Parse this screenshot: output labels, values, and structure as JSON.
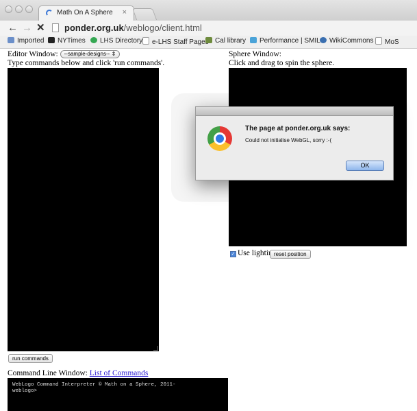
{
  "browser": {
    "tab_title": "Math On A Sphere",
    "tab_close": "×",
    "back_glyph": "←",
    "forward_glyph": "→",
    "stop_glyph": "✕",
    "url_domain": "ponder.org.uk",
    "url_path": "/weblogo/client.html",
    "bookmarks": [
      {
        "label": "Imported",
        "icon": "folder-icon",
        "color": "#6b8fc9"
      },
      {
        "label": "NYTimes",
        "icon": "nytimes-icon",
        "color": "#222222"
      },
      {
        "label": "LHS Directory",
        "icon": "lhs-icon",
        "color": "#35a853"
      },
      {
        "label": "e-LHS Staff Pages",
        "icon": "page-icon",
        "color": "#ffffff"
      },
      {
        "label": "Cal library",
        "icon": "cal-library-icon",
        "color": "#6e8b3d"
      },
      {
        "label": "Performance | SMILE",
        "icon": "smile-icon",
        "color": "#4aa3d8"
      },
      {
        "label": "WikiCommons",
        "icon": "wikicommons-icon",
        "color": "#3a6fb0"
      },
      {
        "label": "MoS",
        "icon": "page-icon",
        "color": "#ffffff"
      }
    ]
  },
  "editor": {
    "label": "Editor Window:",
    "select_value": "--sample-designs--",
    "select_arrow": "⇕",
    "instruction": "Type commands below and click 'run commands'.",
    "run_button": "run commands"
  },
  "sphere": {
    "label": "Sphere Window:",
    "instruction": "Click and drag to spin the sphere.",
    "checkbox_mark": "✓",
    "lighting_label": "Use lighting",
    "lighting_checked": true,
    "reset_button": "reset position"
  },
  "cmdline": {
    "label": "Command Line Window:",
    "link": "List of Commands",
    "line1": "WebLogo Command Interpreter © Math on a Sphere, 2011-",
    "line2": "weblogo>"
  },
  "dialog": {
    "title": "The page at ponder.org.uk says:",
    "message": "Could not initialise WebGL, sorry :-(",
    "ok": "OK"
  }
}
